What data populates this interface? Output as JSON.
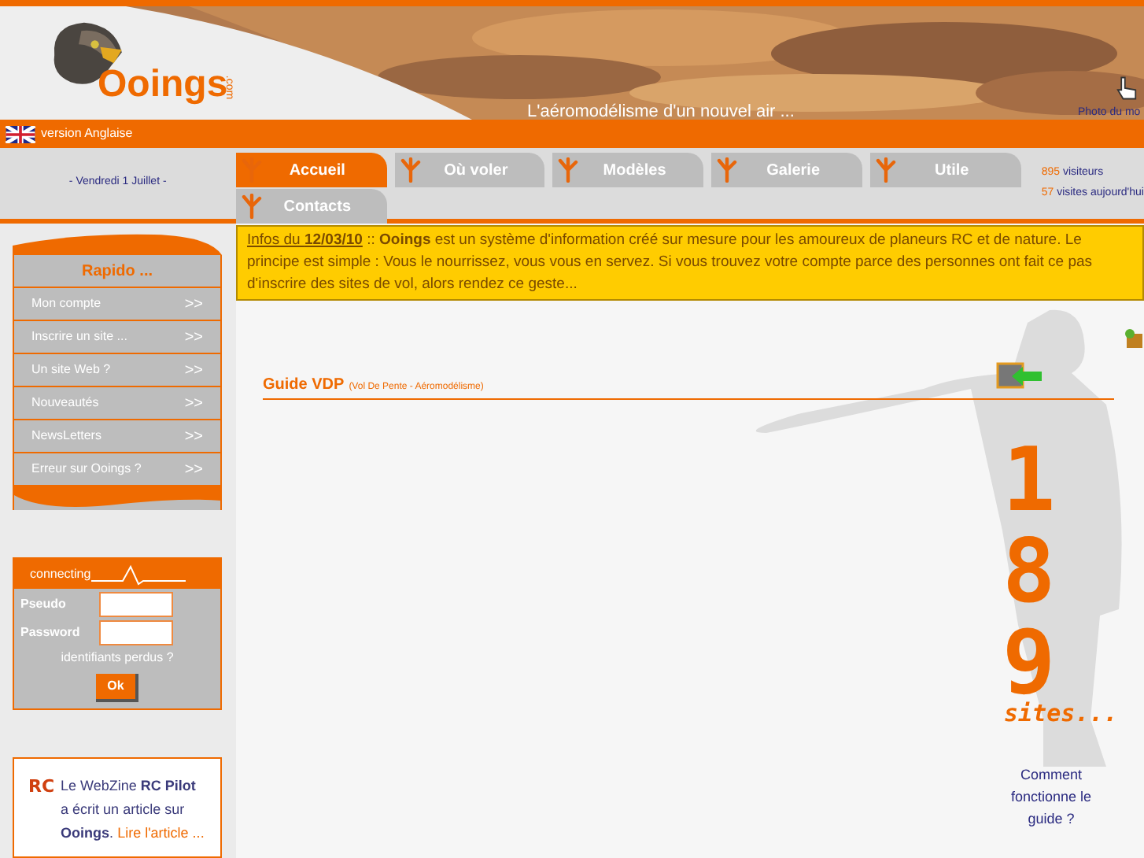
{
  "header": {
    "logo_text": "Ooings",
    "logo_suffix": ".com",
    "tagline": "L'aéromodélisme d'un nouvel air ...",
    "photo_link": "Photo du mo"
  },
  "language_bar": {
    "label": "version Anglaise"
  },
  "date": "- Vendredi 1 Juillet -",
  "tabs": [
    {
      "label": "Accueil",
      "selected": true
    },
    {
      "label": "Où voler",
      "selected": false
    },
    {
      "label": "Modèles",
      "selected": false
    },
    {
      "label": "Galerie",
      "selected": false
    },
    {
      "label": "Utile",
      "selected": false
    },
    {
      "label": "Contacts",
      "selected": false
    }
  ],
  "stats": [
    {
      "count": "895",
      "label": "visiteurs"
    },
    {
      "count": "57",
      "label": "visites aujourd'hui"
    }
  ],
  "sidebar": {
    "title": "Rapido ...",
    "items": [
      {
        "label": "Mon compte",
        "arrow": ">>"
      },
      {
        "label": "Inscrire un site ...",
        "arrow": ">>"
      },
      {
        "label": "Un site Web ?",
        "arrow": ">>"
      },
      {
        "label": "Nouveautés",
        "arrow": ">>"
      },
      {
        "label": "NewsLetters",
        "arrow": ">>"
      },
      {
        "label": "Erreur sur Ooings ?",
        "arrow": ">>"
      }
    ]
  },
  "login": {
    "title": "connecting",
    "fields": [
      {
        "label": "Pseudo"
      },
      {
        "label": "Password"
      }
    ],
    "lost_link": "identifiants perdus ?",
    "submit": "Ok"
  },
  "press": {
    "logo": "RC",
    "text": "Le WebZine **RC Pilot** a écrit un article sur **Ooings**.",
    "link": "Lire l'article ..."
  },
  "news": {
    "link": "Infos du **12/03/10**",
    "text": ":: **Ooings** est un système d'information créé sur mesure pour les amoureux de planeurs RC et de nature. Le principe est simple : Vous le nourrissez, vous vous en servez. Si vous trouvez votre compte parce des personnes ont fait ce pas d'inscrire des sites de vol, alors rendez ce geste..."
  },
  "guide": {
    "title": "Guide VDP",
    "subtitle": "(Vol De Pente - Aéromodélisme)",
    "count": "189",
    "count_suffix": "sites...",
    "help_link": "Comment fonctionne le guide ?"
  }
}
